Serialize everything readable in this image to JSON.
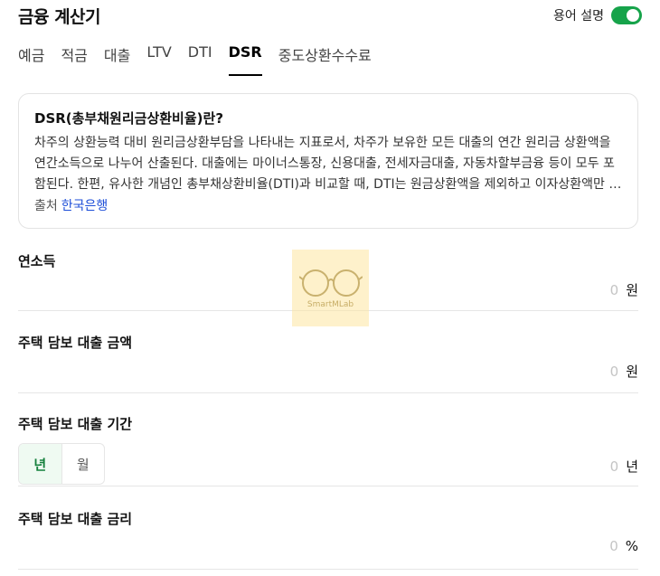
{
  "header": {
    "title": "금융 계산기",
    "term_label": "용어 설명",
    "term_toggle_on": true,
    "accent_color": "#16a34a"
  },
  "tabs": [
    {
      "label": "예금",
      "active": false
    },
    {
      "label": "적금",
      "active": false
    },
    {
      "label": "대출",
      "active": false
    },
    {
      "label": "LTV",
      "active": false
    },
    {
      "label": "DTI",
      "active": false
    },
    {
      "label": "DSR",
      "active": true
    },
    {
      "label": "중도상환수수료",
      "active": false
    }
  ],
  "info": {
    "title": "DSR(총부채원리금상환비율)란?",
    "body": "차주의 상환능력 대비 원리금상환부담을 나타내는 지표로서, 차주가 보유한 모든 대출의 연간 원리금 상환액을 연간소득으로 나누어 산출된다. 대출에는 마이너스통장, 신용대출, 전세자금대출, 자동차할부금융 등이 모두 포함된다. 한편, 유사한 개념인 총부채상환비율(DTI)과 비교할 때, DTI는 원금상환액을 제외하고 이자상환액만 반영한다.",
    "source_label": "출처",
    "source_name": "한국은행"
  },
  "fields": {
    "income": {
      "label": "연소득",
      "value": "0",
      "unit": "원"
    },
    "loan_amount": {
      "label": "주택 담보 대출 금액",
      "value": "0",
      "unit": "원"
    },
    "loan_period": {
      "label": "주택 담보 대출 기간",
      "value": "0",
      "unit": "년",
      "period_options": [
        "년",
        "월"
      ],
      "selected": "년"
    },
    "loan_rate": {
      "label": "주택 담보 대출 금리",
      "value": "0",
      "unit": "%"
    }
  },
  "watermark": {
    "text": "SmartMLab"
  }
}
